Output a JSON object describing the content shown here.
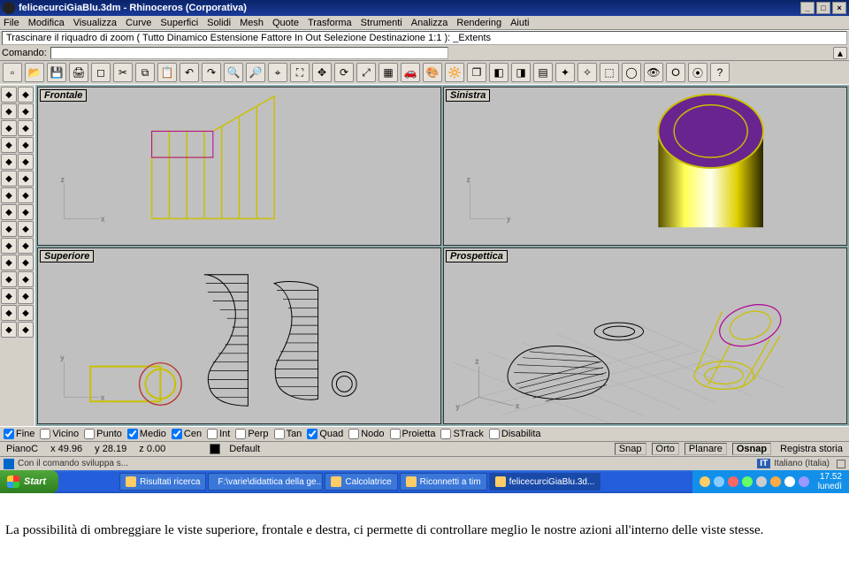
{
  "window": {
    "title": "felicecurciGiaBlu.3dm - Rhinoceros (Corporativa)"
  },
  "menu": {
    "items": [
      "File",
      "Modifica",
      "Visualizza",
      "Curve",
      "Superfici",
      "Solidi",
      "Mesh",
      "Quote",
      "Trasforma",
      "Strumenti",
      "Analizza",
      "Rendering",
      "Aiuti"
    ]
  },
  "cmd": {
    "history": "Trascinare il riquadro di zoom ( Tutto  Dinamico  Estensione  Fattore  In  Out  Selezione  Destinazione  1:1 ): _Extents",
    "label": "Comando:",
    "value": ""
  },
  "top_toolbar": {
    "icons": [
      "new",
      "open",
      "save",
      "print",
      "blank",
      "cut",
      "copy",
      "paste",
      "undo",
      "redo",
      "zoom-in",
      "zoom-out",
      "zoom-area",
      "zoom-ext",
      "move",
      "rotate",
      "scale",
      "grid",
      "render1",
      "render2",
      "render3",
      "layer",
      "layer2",
      "layer3",
      "layer4",
      "prop1",
      "prop2",
      "select",
      "lasso",
      "hide",
      "show",
      "unhide",
      "help"
    ]
  },
  "side_toolbar": {
    "rows": [
      [
        "pointer",
        "line"
      ],
      [
        "spline",
        "arc"
      ],
      [
        "circle",
        "rect"
      ],
      [
        "poly",
        "ellipse"
      ],
      [
        "freeform",
        "curve2"
      ],
      [
        "surf1",
        "surf2"
      ],
      [
        "box",
        "sphere"
      ],
      [
        "cone",
        "cyl"
      ],
      [
        "torus",
        "pipe"
      ],
      [
        "blend",
        "fillet"
      ],
      [
        "bool",
        "split"
      ],
      [
        "explode",
        "join"
      ],
      [
        "group",
        "ungroup"
      ],
      [
        "dim",
        "text"
      ],
      [
        "mesh1",
        "mesh2"
      ]
    ]
  },
  "viewports": {
    "tl": "Frontale",
    "tr": "Sinistra",
    "bl": "Superiore",
    "br": "Prospettica"
  },
  "osnap": {
    "items": [
      {
        "label": "Fine",
        "checked": true
      },
      {
        "label": "Vicino",
        "checked": false
      },
      {
        "label": "Punto",
        "checked": false
      },
      {
        "label": "Medio",
        "checked": true
      },
      {
        "label": "Cen",
        "checked": true
      },
      {
        "label": "Int",
        "checked": false
      },
      {
        "label": "Perp",
        "checked": false
      },
      {
        "label": "Tan",
        "checked": false
      },
      {
        "label": "Quad",
        "checked": true
      },
      {
        "label": "Nodo",
        "checked": false
      },
      {
        "label": "Proietta",
        "checked": false
      },
      {
        "label": "STrack",
        "checked": false
      },
      {
        "label": "Disabilita",
        "checked": false
      }
    ]
  },
  "status": {
    "plane": "PianoC",
    "x": "x 49.96",
    "y": "y 28.19",
    "z": "z 0.00",
    "layer_swatch": "#000000",
    "layer": "Default",
    "toggles": [
      "Snap",
      "Orto",
      "Planare",
      "Osnap",
      "Registra storia"
    ]
  },
  "langbar": {
    "left": "Con il comando sviluppa s...",
    "mid": "IT",
    "lang": "Italiano (Italia)"
  },
  "taskbar": {
    "start": "Start",
    "tasks": [
      {
        "label": "Risultati ricerca",
        "active": false
      },
      {
        "label": "F:\\varie\\didattica della ge...",
        "active": false
      },
      {
        "label": "Calcolatrice",
        "active": false
      },
      {
        "label": "Riconnetti a tim",
        "active": false
      },
      {
        "label": "felicecurciGiaBlu.3d...",
        "active": true
      }
    ],
    "time": "17.52",
    "day": "lunedì"
  },
  "caption": "La possibilità di ombreggiare le viste superiore, frontale e destra, ci permette di controllare meglio le nostre azioni all'interno delle viste stesse."
}
